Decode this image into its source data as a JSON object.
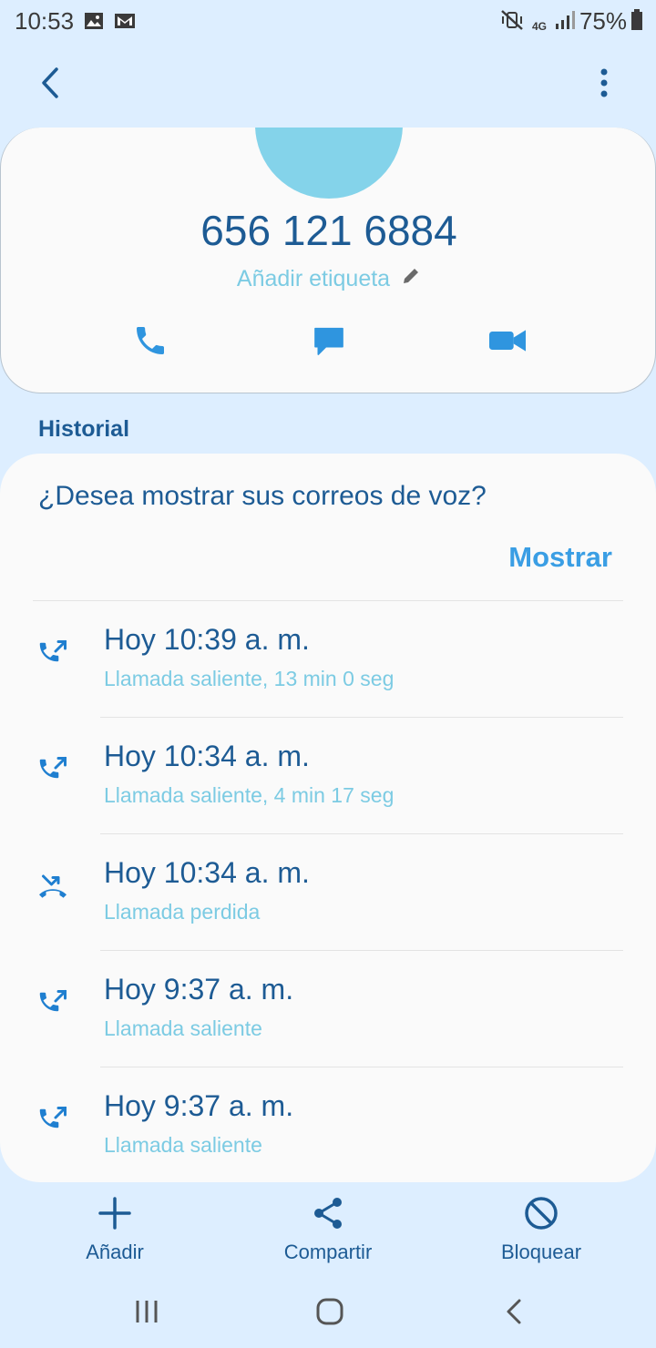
{
  "status_bar": {
    "time": "10:53",
    "network": "4G",
    "battery": "75%"
  },
  "contact": {
    "number": "656 121 6884",
    "add_label": "Añadir etiqueta"
  },
  "history": {
    "title": "Historial",
    "voicemail_prompt": "¿Desea mostrar sus correos de voz?",
    "voicemail_action": "Mostrar",
    "calls": [
      {
        "time": "Hoy 10:39 a. m.",
        "detail": "Llamada saliente, 13 min 0 seg",
        "type": "outgoing"
      },
      {
        "time": "Hoy 10:34 a. m.",
        "detail": "Llamada saliente, 4 min 17 seg",
        "type": "outgoing"
      },
      {
        "time": "Hoy 10:34 a. m.",
        "detail": "Llamada perdida",
        "type": "missed"
      },
      {
        "time": "Hoy 9:37 a. m.",
        "detail": "Llamada saliente",
        "type": "outgoing"
      },
      {
        "time": "Hoy 9:37 a. m.",
        "detail": "Llamada saliente",
        "type": "outgoing"
      }
    ]
  },
  "bottom_bar": {
    "add": "Añadir",
    "share": "Compartir",
    "block": "Bloquear"
  },
  "colors": {
    "background": "#ddeeff",
    "card": "#fafafa",
    "primary_text": "#1d5b94",
    "secondary_text": "#7ccbe3",
    "accent": "#3a9ee4",
    "avatar": "#84d3ea"
  },
  "icons": [
    "back-arrow-icon",
    "more-options-icon",
    "phone-icon",
    "message-icon",
    "video-call-icon",
    "pencil-icon",
    "outgoing-call-icon",
    "missed-call-icon",
    "plus-icon",
    "share-icon",
    "block-icon",
    "recent-apps-icon",
    "home-icon",
    "nav-back-icon"
  ]
}
